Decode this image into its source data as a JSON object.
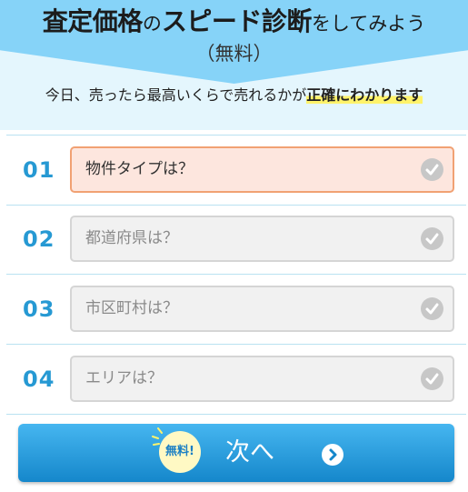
{
  "header": {
    "title_part1": "査定価格",
    "title_part2": "の",
    "title_part3": "スピード診断",
    "title_part4": "をしてみよう",
    "subtitle": "（無料）",
    "tagline_prefix": "今日、売ったら最高いくらで売れるかが",
    "tagline_highlight": "正確にわかります"
  },
  "steps": [
    {
      "number": "01",
      "placeholder": "物件タイプは？",
      "active": true
    },
    {
      "number": "02",
      "placeholder": "都道府県は？",
      "active": false
    },
    {
      "number": "03",
      "placeholder": "市区町村は？",
      "active": false
    },
    {
      "number": "04",
      "placeholder": "エリアは？",
      "active": false
    }
  ],
  "next_button": {
    "badge": "無料!",
    "label": "次へ"
  },
  "colors": {
    "accent": "#2699d3",
    "active_border": "#f1a173",
    "active_bg": "#fde6de",
    "highlight": "#fff36b"
  },
  "icons": {
    "field_check": "check-circle-icon",
    "next_arrow": "chevron-right-icon"
  }
}
